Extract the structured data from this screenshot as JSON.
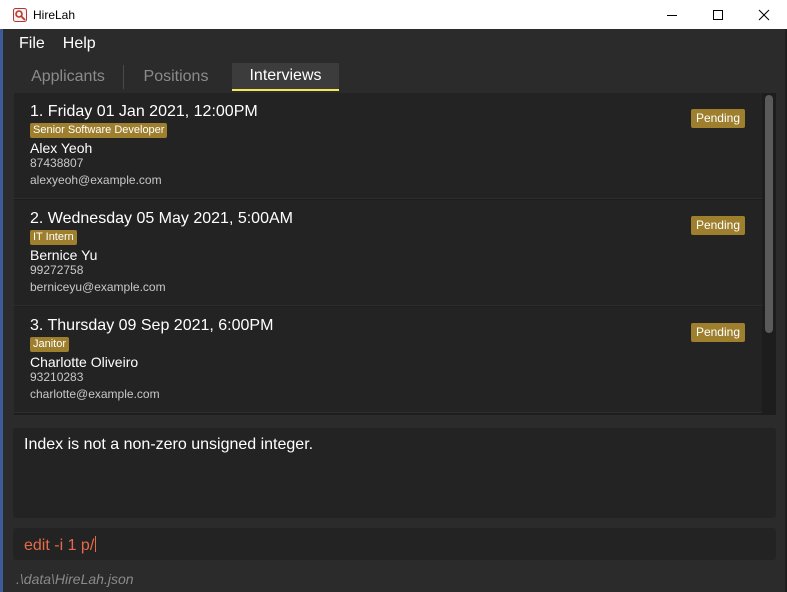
{
  "window": {
    "title": "HireLah",
    "controls": {
      "minimize": "minimize-icon",
      "maximize": "maximize-icon",
      "close": "close-icon"
    }
  },
  "menu": {
    "items": [
      "File",
      "Help"
    ]
  },
  "tabs": [
    {
      "label": "Applicants",
      "active": false
    },
    {
      "label": "Positions",
      "active": false
    },
    {
      "label": "Interviews",
      "active": true
    }
  ],
  "interviews": [
    {
      "title": "1.  Friday 01 Jan 2021, 12:00PM",
      "position": "Senior Software Developer",
      "name": "Alex Yeoh",
      "phone": "87438807",
      "email": "alexyeoh@example.com",
      "status": "Pending"
    },
    {
      "title": "2.  Wednesday 05 May 2021, 5:00AM",
      "position": "IT Intern",
      "name": "Bernice Yu",
      "phone": "99272758",
      "email": "berniceyu@example.com",
      "status": "Pending"
    },
    {
      "title": "3.  Thursday 09 Sep 2021, 6:00PM",
      "position": "Janitor",
      "name": "Charlotte Oliveiro",
      "phone": "93210283",
      "email": "charlotte@example.com",
      "status": "Pending"
    }
  ],
  "result": {
    "message": "Index is not a non-zero unsigned integer."
  },
  "command": {
    "value": "edit -i 1 p/"
  },
  "status_bar": {
    "path": ".\\data\\HireLah.json"
  },
  "colors": {
    "accent_tab_underline": "#f5e65a",
    "badge": "#9e7f2e",
    "command_text": "#e56a4a",
    "background": "#2b2b2b"
  }
}
